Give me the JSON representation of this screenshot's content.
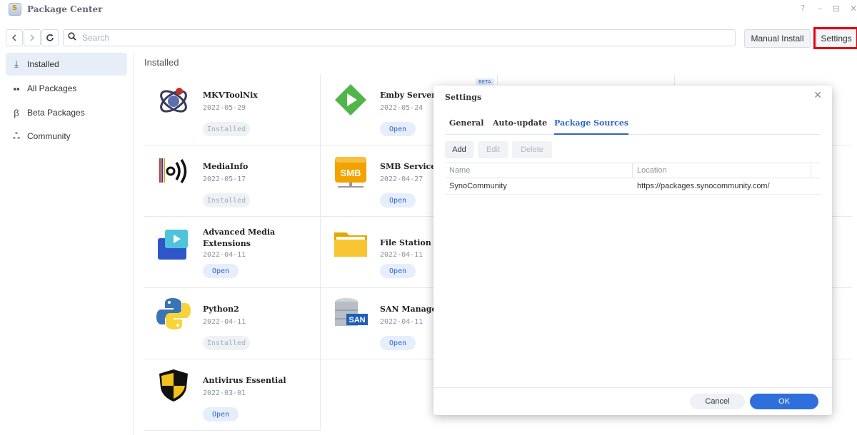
{
  "window": {
    "title": "Package Center",
    "controls": [
      "?",
      "–",
      "⊟",
      "✕"
    ]
  },
  "toolbar": {
    "search_placeholder": "Search",
    "manual_install_label": "Manual Install",
    "settings_label": "Settings"
  },
  "sidebar": {
    "items": [
      {
        "label": "Installed",
        "icon": "download-icon",
        "active": true
      },
      {
        "label": "All Packages",
        "icon": "grid-icon",
        "active": false
      },
      {
        "label": "Beta Packages",
        "icon": "beta-icon",
        "active": false
      },
      {
        "label": "Community",
        "icon": "community-icon",
        "active": false
      }
    ]
  },
  "main": {
    "title": "Installed",
    "packages": [
      {
        "name": "MKVToolNix",
        "date": "2022-05-29",
        "action": "Installed",
        "icon": "mkvtoolnix-icon"
      },
      {
        "name": "Emby Server",
        "date": "2022-05-24",
        "action": "Open",
        "icon": "emby-icon",
        "badge": "BETA"
      },
      {
        "name": "MediaInfo",
        "date": "2022-05-17",
        "action": "Installed",
        "icon": "mediainfo-icon"
      },
      {
        "name": "SMB Service",
        "date": "2022-04-27",
        "action": "Open",
        "icon": "smb-icon"
      },
      {
        "name": "Advanced Media Extensions",
        "date": "2022-04-11",
        "action": "Open",
        "icon": "media-extensions-icon"
      },
      {
        "name": "File Station",
        "date": "2022-04-11",
        "action": "Open",
        "icon": "folder-icon"
      },
      {
        "name": "Python2",
        "date": "2022-04-11",
        "action": "Installed",
        "icon": "python-icon"
      },
      {
        "name": "SAN Manager",
        "date": "2022-04-11",
        "action": "Open",
        "icon": "san-icon"
      },
      {
        "name": "Antivirus Essential",
        "date": "2022-03-01",
        "action": "Open",
        "icon": "antivirus-shield-icon"
      }
    ]
  },
  "dialog": {
    "title": "Settings",
    "tabs": [
      "General",
      "Auto-update",
      "Package Sources"
    ],
    "active_tab": "Package Sources",
    "buttons": {
      "add": "Add",
      "edit": "Edit",
      "delete": "Delete"
    },
    "columns": [
      "Name",
      "Location"
    ],
    "rows": [
      {
        "name": "SynoCommunity",
        "location": "https://packages.synocommunity.com/"
      }
    ],
    "cancel_label": "Cancel",
    "ok_label": "OK"
  },
  "colors": {
    "accent": "#2d63c8",
    "highlight": "#e00012",
    "ok_button": "#2f6fdb"
  }
}
